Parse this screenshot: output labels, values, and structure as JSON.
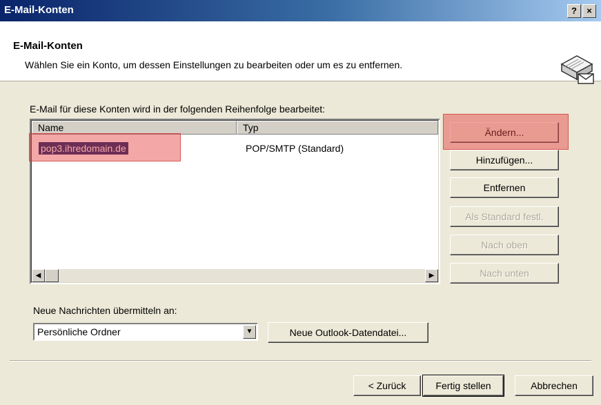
{
  "window": {
    "title": "E-Mail-Konten",
    "help_button": "?",
    "close_button": "×"
  },
  "header": {
    "title": "E-Mail-Konten",
    "subtitle": "Wählen Sie ein Konto, um dessen Einstellungen zu bearbeiten oder um es zu entfernen."
  },
  "accounts": {
    "label": "E-Mail für diese Konten wird in der folgenden Reihenfolge bearbeitet:",
    "columns": [
      "Name",
      "Typ"
    ],
    "rows": [
      {
        "name": "pop3.ihredomain.de",
        "type": "POP/SMTP (Standard)"
      }
    ]
  },
  "side_buttons": {
    "change": "Ändern...",
    "add": "Hinzufügen...",
    "remove": "Entfernen",
    "set_default": "Als Standard festl.",
    "move_up": "Nach oben",
    "move_down": "Nach unten"
  },
  "delivery": {
    "label": "Neue Nachrichten übermitteln an:",
    "selected": "Persönliche Ordner",
    "new_file_button": "Neue Outlook-Datendatei..."
  },
  "footer": {
    "back": "< Zurück",
    "finish": "Fertig stellen",
    "cancel": "Abbrechen"
  },
  "colors": {
    "selection": "#0a246a",
    "highlight": "#e63c3c",
    "face": "#ece9d8"
  }
}
